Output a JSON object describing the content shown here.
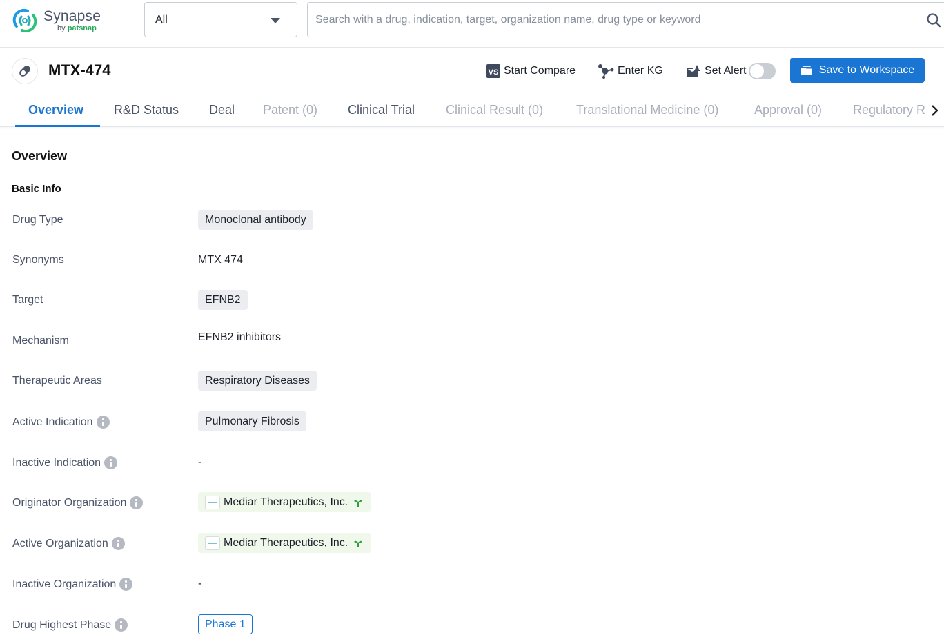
{
  "app": {
    "name": "Synapse",
    "byline_prefix": "by ",
    "byline_brand": "patsnap"
  },
  "search": {
    "scope_value": "All",
    "placeholder": "Search with a drug, indication, target, organization name, drug type or keyword",
    "value": ""
  },
  "drug": {
    "title": "MTX-474"
  },
  "actions": {
    "compare_label": "Start Compare",
    "kg_label": "Enter KG",
    "alert_label": "Set Alert",
    "alert_enabled": false,
    "save_label": "Save to Workspace"
  },
  "colors": {
    "accent": "#1a76d2",
    "brand_green": "#2aa85a",
    "tag_bg": "#ebedf0",
    "org_tag_bg": "#f0f8ec"
  },
  "tabs": [
    {
      "label": "Overview",
      "state": "active"
    },
    {
      "label": "R&D Status",
      "state": "normal"
    },
    {
      "label": "Deal",
      "state": "normal"
    },
    {
      "label": "Patent (0)",
      "state": "disabled"
    },
    {
      "label": "Clinical Trial",
      "state": "normal"
    },
    {
      "label": "Clinical Result (0)",
      "state": "disabled"
    },
    {
      "label": "Translational Medicine (0)",
      "state": "disabled"
    },
    {
      "label": "Approval (0)",
      "state": "disabled"
    },
    {
      "label": "Regulatory R",
      "state": "disabled"
    }
  ],
  "overview": {
    "section_title": "Overview",
    "subsection_title": "Basic Info",
    "fields": {
      "drug_type": {
        "label": "Drug Type",
        "value": "Monoclonal antibody"
      },
      "synonyms": {
        "label": "Synonyms",
        "value": "MTX 474"
      },
      "target": {
        "label": "Target",
        "value": "EFNB2"
      },
      "mechanism": {
        "label": "Mechanism",
        "value": "EFNB2 inhibitors"
      },
      "therapeutic_areas": {
        "label": "Therapeutic Areas",
        "value": "Respiratory Diseases"
      },
      "active_indication": {
        "label": "Active Indication",
        "value": "Pulmonary Fibrosis"
      },
      "inactive_indication": {
        "label": "Inactive Indication",
        "value": "-"
      },
      "originator_org": {
        "label": "Originator Organization",
        "value": "Mediar Therapeutics, Inc."
      },
      "active_org": {
        "label": "Active Organization",
        "value": "Mediar Therapeutics, Inc."
      },
      "inactive_org": {
        "label": "Inactive Organization",
        "value": "-"
      },
      "highest_phase": {
        "label": "Drug Highest Phase",
        "value": "Phase 1"
      }
    }
  }
}
